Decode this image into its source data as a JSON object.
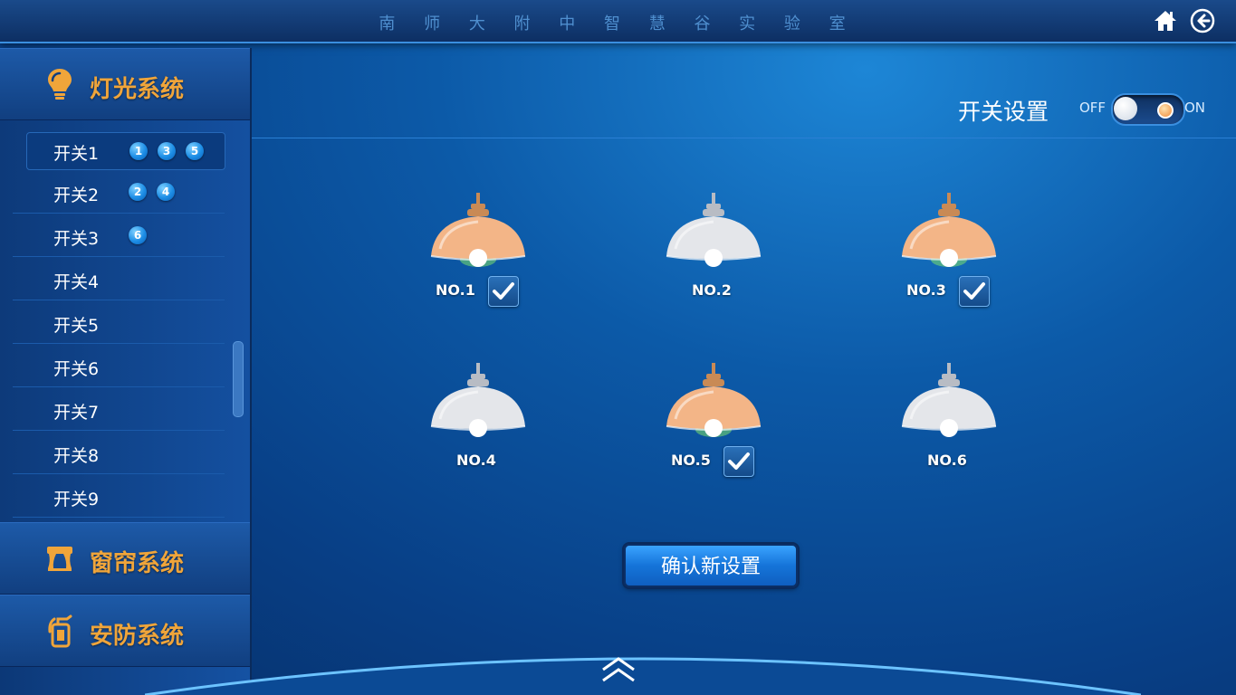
{
  "header": {
    "title": "南 师 大 附 中 智 慧 谷 实 验 室",
    "home_icon": "home-icon",
    "back_icon": "arrow-left-circle-icon"
  },
  "sidebar": {
    "lighting": {
      "label": "灯光系统",
      "icon": "lightbulb-icon"
    },
    "switches": [
      {
        "label": "开关1",
        "badges": [
          "1",
          "3",
          "5"
        ],
        "active": true
      },
      {
        "label": "开关2",
        "badges": [
          "2",
          "4"
        ]
      },
      {
        "label": "开关3",
        "badges": [
          "6"
        ]
      },
      {
        "label": "开关4",
        "badges": []
      },
      {
        "label": "开关5",
        "badges": []
      },
      {
        "label": "开关6",
        "badges": []
      },
      {
        "label": "开关7",
        "badges": []
      },
      {
        "label": "开关8",
        "badges": []
      },
      {
        "label": "开关9",
        "badges": []
      }
    ],
    "curtain": {
      "label": "窗帘系统",
      "icon": "curtain-icon"
    },
    "security": {
      "label": "安防系统",
      "icon": "extinguisher-icon"
    }
  },
  "settings": {
    "label": "开关设置",
    "off_label": "OFF",
    "on_label": "ON",
    "toggle_state": "on"
  },
  "lamps": [
    {
      "label": "NO.1",
      "lit": true,
      "checked": true
    },
    {
      "label": "NO.2",
      "lit": false,
      "checked": false
    },
    {
      "label": "NO.3",
      "lit": true,
      "checked": true
    },
    {
      "label": "NO.4",
      "lit": false,
      "checked": false
    },
    {
      "label": "NO.5",
      "lit": true,
      "checked": true
    },
    {
      "label": "NO.6",
      "lit": false,
      "checked": false
    }
  ],
  "confirm_label": "确认新设置",
  "colors": {
    "accent_orange": "#f0a53a",
    "lamp_lit": "#f3b587",
    "lamp_off": "#e4e6ea",
    "badge_blue": "#1d8ee6"
  }
}
